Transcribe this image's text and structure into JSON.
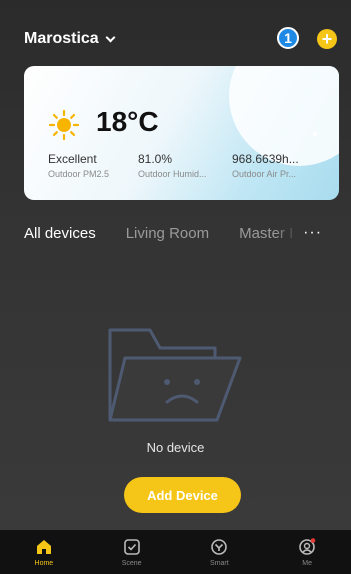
{
  "header": {
    "home_name": "Marostica",
    "notification_count": "1",
    "add_symbol": "+"
  },
  "weather": {
    "temperature": "18°C",
    "stats": [
      {
        "value": "Excellent",
        "label": "Outdoor PM2.5"
      },
      {
        "value": "81.0%",
        "label": "Outdoor Humid..."
      },
      {
        "value": "968.6639h...",
        "label": "Outdoor Air Pr..."
      }
    ]
  },
  "tabs": [
    "All devices",
    "Living Room",
    "Master I"
  ],
  "more_symbol": "···",
  "empty": {
    "message": "No device",
    "button": "Add Device"
  },
  "nav": [
    {
      "label": "Home",
      "icon": "home-icon",
      "active": true
    },
    {
      "label": "Scene",
      "icon": "scene-icon",
      "active": false
    },
    {
      "label": "Smart",
      "icon": "smart-icon",
      "active": false
    },
    {
      "label": "Me",
      "icon": "profile-icon",
      "active": false
    }
  ],
  "colors": {
    "accent": "#f5c518",
    "badge": "#1e88e5",
    "background": "#333333",
    "nav_bg": "#111111"
  }
}
